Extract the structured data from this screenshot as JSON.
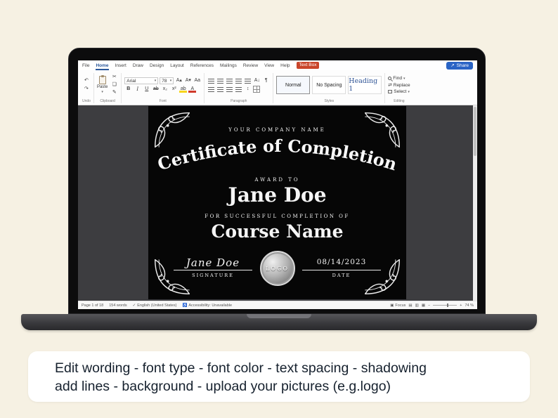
{
  "colors": {
    "page_background": "#f6f1e3",
    "caption_background": "#ffffff",
    "caption_text": "#16212e",
    "share_button": "#2a64c5",
    "contextual_tab": "#c9452a",
    "active_tab": "#2b579a",
    "heading1_style": "#2f5496",
    "certificate_background": "#060606",
    "certificate_text": "#f5f5f5",
    "document_canvas": "#3d3d40"
  },
  "word": {
    "tabs": [
      "File",
      "Home",
      "Insert",
      "Draw",
      "Design",
      "Layout",
      "References",
      "Mailings",
      "Review",
      "View",
      "Help"
    ],
    "contextual_tab": "Text Box",
    "share_label": "Share",
    "ribbon": {
      "paste_label": "Paste",
      "font_name": "Arial",
      "font_size": "78",
      "style_normal": "Normal",
      "style_no_spacing": "No Spacing",
      "style_heading1": "Heading 1",
      "find": "Find",
      "replace": "Replace",
      "select": "Select",
      "groups": [
        "Undo",
        "Clipboard",
        "Font",
        "Paragraph",
        "Styles",
        "Editing"
      ]
    },
    "status": {
      "page": "Page 1 of 18",
      "words": "154 words",
      "language": "English (United States)",
      "accessibility": "Accessibility: Unavailable",
      "focus": "Focus",
      "zoom": "74 %"
    }
  },
  "icons": {
    "undo": "↶",
    "redo": "↷",
    "cut": "✂",
    "copy": "❏",
    "format_painter": "✎",
    "dropdown": "▾",
    "grow_font": "A▴",
    "shrink_font": "A▾",
    "change_case": "Aa",
    "bold": "B",
    "italic": "I",
    "underline": "U",
    "strikethrough": "ab",
    "subscript": "x₂",
    "superscript": "x²",
    "highlight": "ab",
    "font_color": "A",
    "sort": "A↓",
    "paragraph_mark": "¶",
    "line_spacing": "↕",
    "replace_swap": "⇄",
    "share": "↗",
    "proofing_check": "✓",
    "accessibility_person": "♿",
    "focus_box": "▣",
    "view_read": "▤",
    "view_print": "▥",
    "view_web": "▦",
    "zoom_out": "−",
    "zoom_in": "+"
  },
  "certificate": {
    "company": "YOUR COMPANY NAME",
    "title": "Certificate of Completion",
    "award_to": "AWARD TO",
    "recipient": "Jane Doe",
    "subtitle": "FOR SUCCESSFUL COMPLETION OF",
    "course": "Course Name",
    "signature_name": "Jane Doe",
    "signature_label": "SIGNATURE",
    "logo_label": "LOGO",
    "date_value": "08/14/2023",
    "date_label": "DATE"
  },
  "caption": {
    "line1": "Edit wording - font type - font color - text spacing - shadowing",
    "line2": "add lines - background -  upload your pictures (e.g.logo)"
  }
}
